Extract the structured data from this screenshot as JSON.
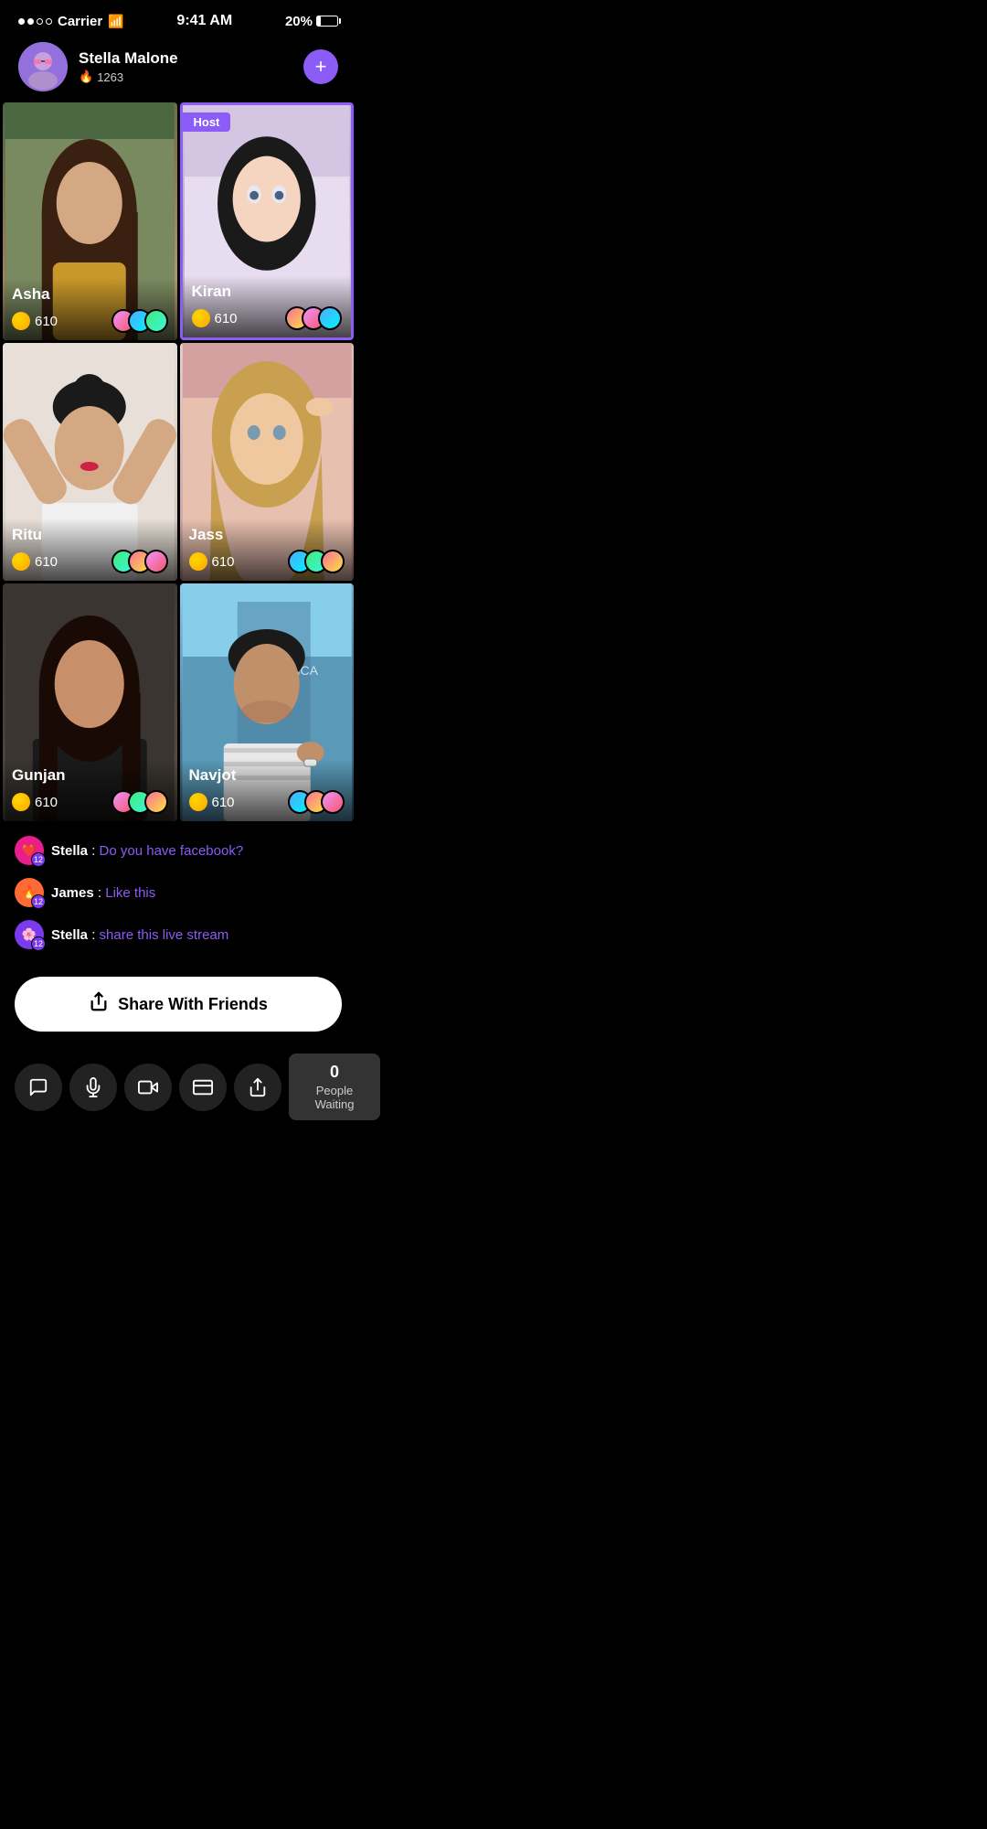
{
  "statusBar": {
    "carrier": "Carrier",
    "time": "9:41 AM",
    "battery": "20%"
  },
  "profile": {
    "name": "Stella Malone",
    "score": "1263",
    "addLabel": "+"
  },
  "streams": [
    {
      "id": "asha",
      "name": "Asha",
      "coins": "610",
      "isHost": false,
      "bgClass": "bg-asha"
    },
    {
      "id": "kiran",
      "name": "Kiran",
      "coins": "610",
      "isHost": true,
      "bgClass": "bg-kiran"
    },
    {
      "id": "ritu",
      "name": "Ritu",
      "coins": "610",
      "isHost": false,
      "bgClass": "bg-ritu"
    },
    {
      "id": "jass",
      "name": "Jass",
      "coins": "610",
      "isHost": false,
      "bgClass": "bg-jass"
    },
    {
      "id": "gunjan",
      "name": "Gunjan",
      "coins": "610",
      "isHost": false,
      "bgClass": "bg-gunjan"
    },
    {
      "id": "navjot",
      "name": "Navjot",
      "coins": "610",
      "isHost": false,
      "bgClass": "bg-navjot"
    }
  ],
  "hostLabel": "Host",
  "chat": [
    {
      "user": "Stella",
      "badge": "heart",
      "level": "12",
      "message": "Do you have facebook?",
      "badgeClass": "badge-heart"
    },
    {
      "user": "James",
      "badge": "fire",
      "level": "12",
      "message": "Like this",
      "badgeClass": "badge-fire"
    },
    {
      "user": "Stella",
      "badge": "purple",
      "level": "12",
      "message": "share this live stream",
      "badgeClass": "badge-purple"
    }
  ],
  "shareButton": {
    "label": "Share With Friends"
  },
  "bottomBar": {
    "buttons": [
      "chat",
      "mic",
      "video",
      "wallet",
      "share"
    ]
  },
  "waiting": {
    "count": "0",
    "label": "People Waiting"
  }
}
